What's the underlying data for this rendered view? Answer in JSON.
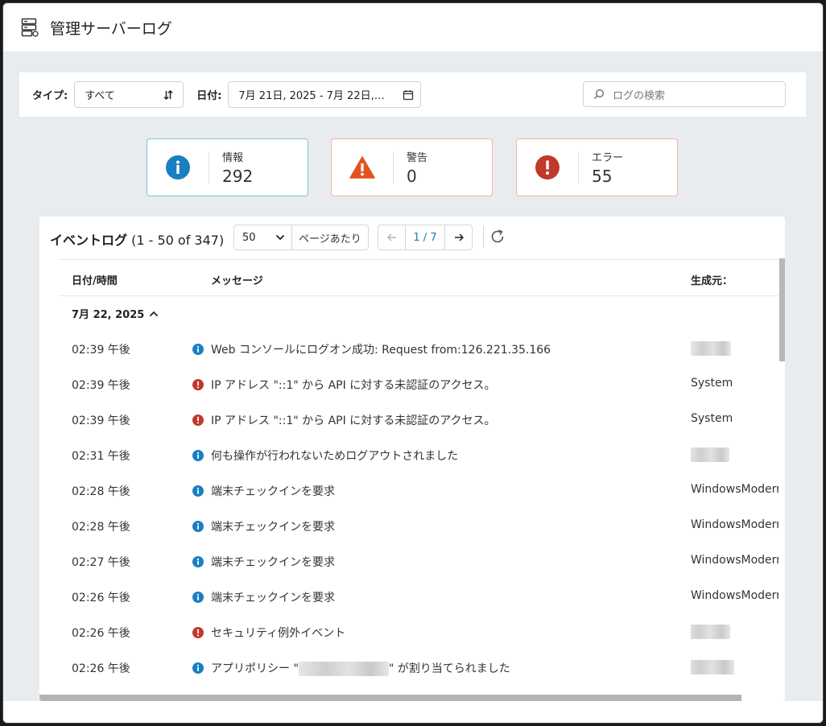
{
  "header": {
    "title": "管理サーバーログ",
    "icon": "server-icon"
  },
  "filters": {
    "type_label": "タイプ:",
    "type_value": "すべて",
    "date_label": "日付:",
    "date_value": "7月 21日, 2025 - 7月 22日,…",
    "search_placeholder": "ログの検索"
  },
  "summary": {
    "info": {
      "label": "情報",
      "count": "292",
      "color": "#1a7fc1"
    },
    "warning": {
      "label": "警告",
      "count": "0",
      "color": "#e0541f"
    },
    "error": {
      "label": "エラー",
      "count": "55",
      "color": "#c0392b"
    }
  },
  "eventlog": {
    "title": "イベントログ",
    "range": "(1 - 50 of 347)",
    "per_page_value": "50",
    "per_page_label": "ページあたり",
    "page": "1 / 7",
    "columns": {
      "datetime": "日付/時間",
      "message": "メッセージ",
      "source": "生成元："
    },
    "group_date": "7月 22, 2025",
    "rows": [
      {
        "time": "02:39 午後",
        "level": "info",
        "message": "Web コンソールにログオン成功: Request from:126.221.35.166",
        "source": ""
      },
      {
        "time": "02:39 午後",
        "level": "error",
        "message": "IP アドレス \"::1\" から API に対する未認証のアクセス。",
        "source": "System"
      },
      {
        "time": "02:39 午後",
        "level": "error",
        "message": "IP アドレス \"::1\" から API に対する未認証のアクセス。",
        "source": "System"
      },
      {
        "time": "02:31 午後",
        "level": "info",
        "message": "何も操作が行われないためログアウトされました",
        "source": ""
      },
      {
        "time": "02:28 午後",
        "level": "info",
        "message": "端末チェックインを要求",
        "source": "WindowsModern"
      },
      {
        "time": "02:28 午後",
        "level": "info",
        "message": "端末チェックインを要求",
        "source": "WindowsModern"
      },
      {
        "time": "02:27 午後",
        "level": "info",
        "message": "端末チェックインを要求",
        "source": "WindowsModern"
      },
      {
        "time": "02:26 午後",
        "level": "info",
        "message": "端末チェックインを要求",
        "source": "WindowsModern"
      },
      {
        "time": "02:26 午後",
        "level": "error",
        "message": "セキュリティ例外イベント",
        "source": ""
      },
      {
        "time": "02:26 午後",
        "level": "info",
        "message_prefix": "アプリポリシー \"",
        "message_suffix": "\" が割り当てられました",
        "source": ""
      }
    ]
  }
}
